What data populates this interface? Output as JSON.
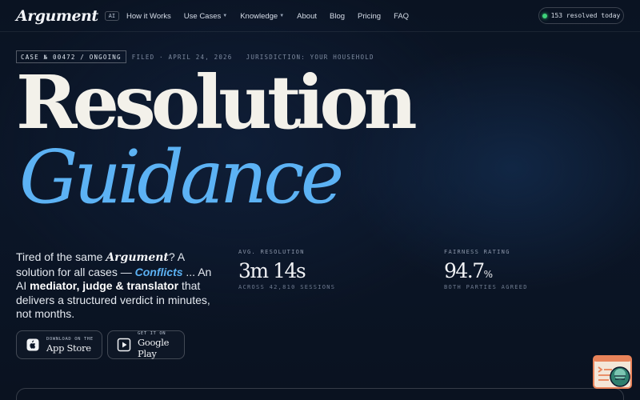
{
  "brand": {
    "name": "Argument",
    "badge": "AI"
  },
  "nav": {
    "links": [
      {
        "label": "How it Works"
      },
      {
        "label": "Use Cases",
        "dropdown": true
      },
      {
        "label": "Knowledge",
        "dropdown": true
      },
      {
        "label": "About"
      },
      {
        "label": "Blog"
      },
      {
        "label": "Pricing"
      },
      {
        "label": "FAQ"
      }
    ],
    "status_pill": "153 resolved today"
  },
  "case": {
    "badge": "CASE № 00472 / ONGOING",
    "meta": "FILED · APRIL 24, 2026   JURISDICTION: YOUR HOUSEHOLD"
  },
  "hero": {
    "title_line1": "Resolution",
    "title_line2": "Guidance",
    "desc_1": "Tired of the same ",
    "desc_brand": "Argument",
    "desc_2": "? A solution for all cases — ",
    "desc_conflicts": "Conflicts",
    "desc_3": " ... An AI ",
    "desc_bold": "mediator, judge & translator",
    "desc_4": " that delivers a structured verdict in minutes, not months."
  },
  "store": {
    "app_store": {
      "small": "DOWNLOAD ON THE",
      "big": "App Store"
    },
    "google_play": {
      "small": "GET IT ON",
      "big": "Google Play"
    }
  },
  "stats": [
    {
      "label": "AVG. RESOLUTION",
      "value": "3m 14s",
      "unit": "",
      "sub": "ACROSS 42,810 SESSIONS"
    },
    {
      "label": "FAIRNESS RATING",
      "value": "94.7",
      "unit": "%",
      "sub": "BOTH PARTIES AGREED"
    }
  ],
  "colors": {
    "background": "#0b1628",
    "accent_blue": "#5cb2f4",
    "title_cream": "#f3f1ea",
    "status_green": "#3ed37a",
    "widget_orange": "#e8835a"
  }
}
